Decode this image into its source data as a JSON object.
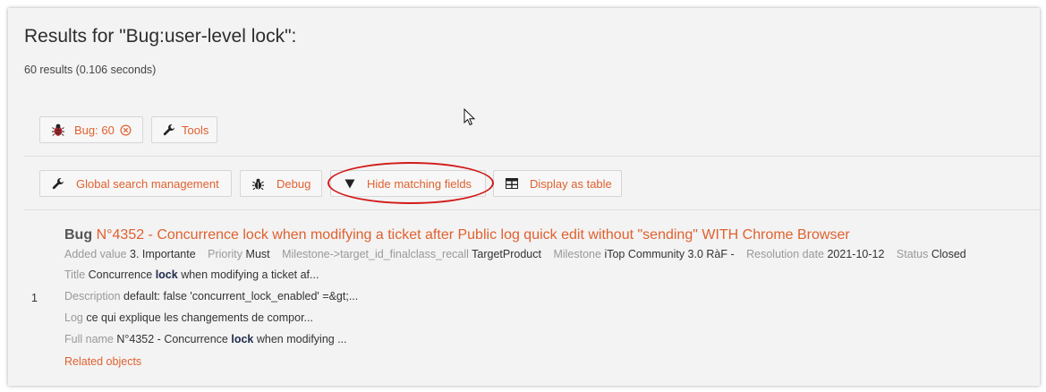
{
  "header": {
    "title": "Results for \"Bug:user-level lock\":",
    "count": "60 results (0.106 seconds)"
  },
  "filters": {
    "bug_label": "Bug: 60",
    "tools_label": "Tools"
  },
  "actions": {
    "global_search_label": "Global search management",
    "debug_label": "Debug",
    "hide_fields_label": "Hide matching fields",
    "display_table_label": "Display as table"
  },
  "result": {
    "index": "1",
    "class": "Bug",
    "title": "N°4352 - Concurrence lock when modifying a ticket after Public log quick edit without \"sending\" WITH Chrome Browser",
    "attrs": {
      "added_value_label": "Added value",
      "added_value": "3. Importante",
      "priority_label": "Priority",
      "priority": "Must",
      "milestone_target_label": "Milestone->target_id_finalclass_recall",
      "milestone_target": "TargetProduct",
      "milestone_label": "Milestone",
      "milestone": "iTop Community 3.0 RàF -",
      "resolution_label": "Resolution date",
      "resolution": "2021-10-12",
      "status_label": "Status",
      "status": "Closed"
    },
    "fields": {
      "title_label": "Title",
      "title_pre": "Concurrence",
      "title_hl": "lock",
      "title_post": "when modifying a ticket af...",
      "description_label": "Description",
      "description": "default: false 'concurrent_lock_enabled' =&gt;...",
      "log_label": "Log",
      "log": "ce qui explique les changements de compor...",
      "fullname_label": "Full name",
      "fullname_pre": "N°4352 - Concurrence",
      "fullname_hl": "lock",
      "fullname_post": "when modifying ..."
    },
    "related_label": "Related objects"
  },
  "icons": [
    "bug-icon",
    "close-circle-icon",
    "wrench-icon",
    "debug-icon",
    "triangle-down-icon",
    "table-icon",
    "mouse-cursor-icon"
  ],
  "colors": {
    "accent": "#e0612f",
    "highlight": "#d21a1a",
    "panel": "#f3f3f3"
  }
}
